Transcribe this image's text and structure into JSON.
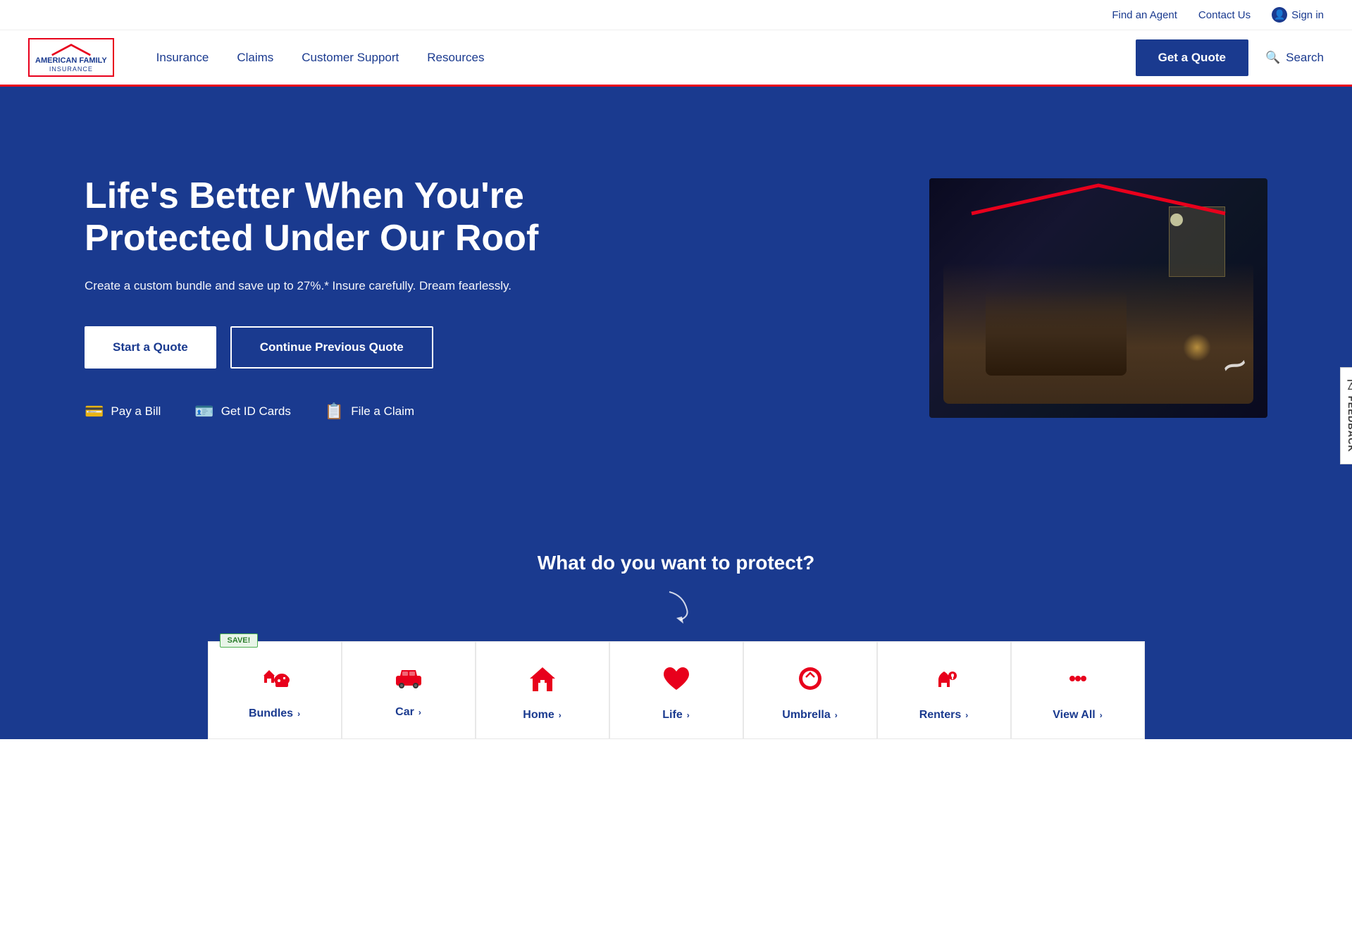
{
  "topbar": {
    "find_agent": "Find an Agent",
    "contact_us": "Contact Us",
    "sign_in": "Sign in"
  },
  "nav": {
    "insurance": "Insurance",
    "claims": "Claims",
    "customer_support": "Customer Support",
    "resources": "Resources",
    "get_quote": "Get a Quote",
    "search": "Search",
    "logo_line1": "AMERICAN FAMILY",
    "logo_line2": "INSURANCE"
  },
  "hero": {
    "title": "Life's Better When You're Protected Under Our Roof",
    "subtitle": "Create a custom bundle and save up to 27%.* Insure carefully. Dream fearlessly.",
    "start_quote": "Start a Quote",
    "continue_quote": "Continue Previous Quote",
    "pay_bill": "Pay a Bill",
    "get_id_cards": "Get ID Cards",
    "file_claim": "File a Claim"
  },
  "protect": {
    "title": "What do you want to protect?"
  },
  "products": [
    {
      "label": "Bundles",
      "icon": "bundles",
      "save": true
    },
    {
      "label": "Car",
      "icon": "car",
      "save": false
    },
    {
      "label": "Home",
      "icon": "home",
      "save": false
    },
    {
      "label": "Life",
      "icon": "life",
      "save": false
    },
    {
      "label": "Umbrella",
      "icon": "umbrella",
      "save": false
    },
    {
      "label": "Renters",
      "icon": "renters",
      "save": false
    },
    {
      "label": "View All",
      "icon": "more",
      "save": false
    }
  ],
  "feedback": {
    "label": "FEEDBACK"
  }
}
